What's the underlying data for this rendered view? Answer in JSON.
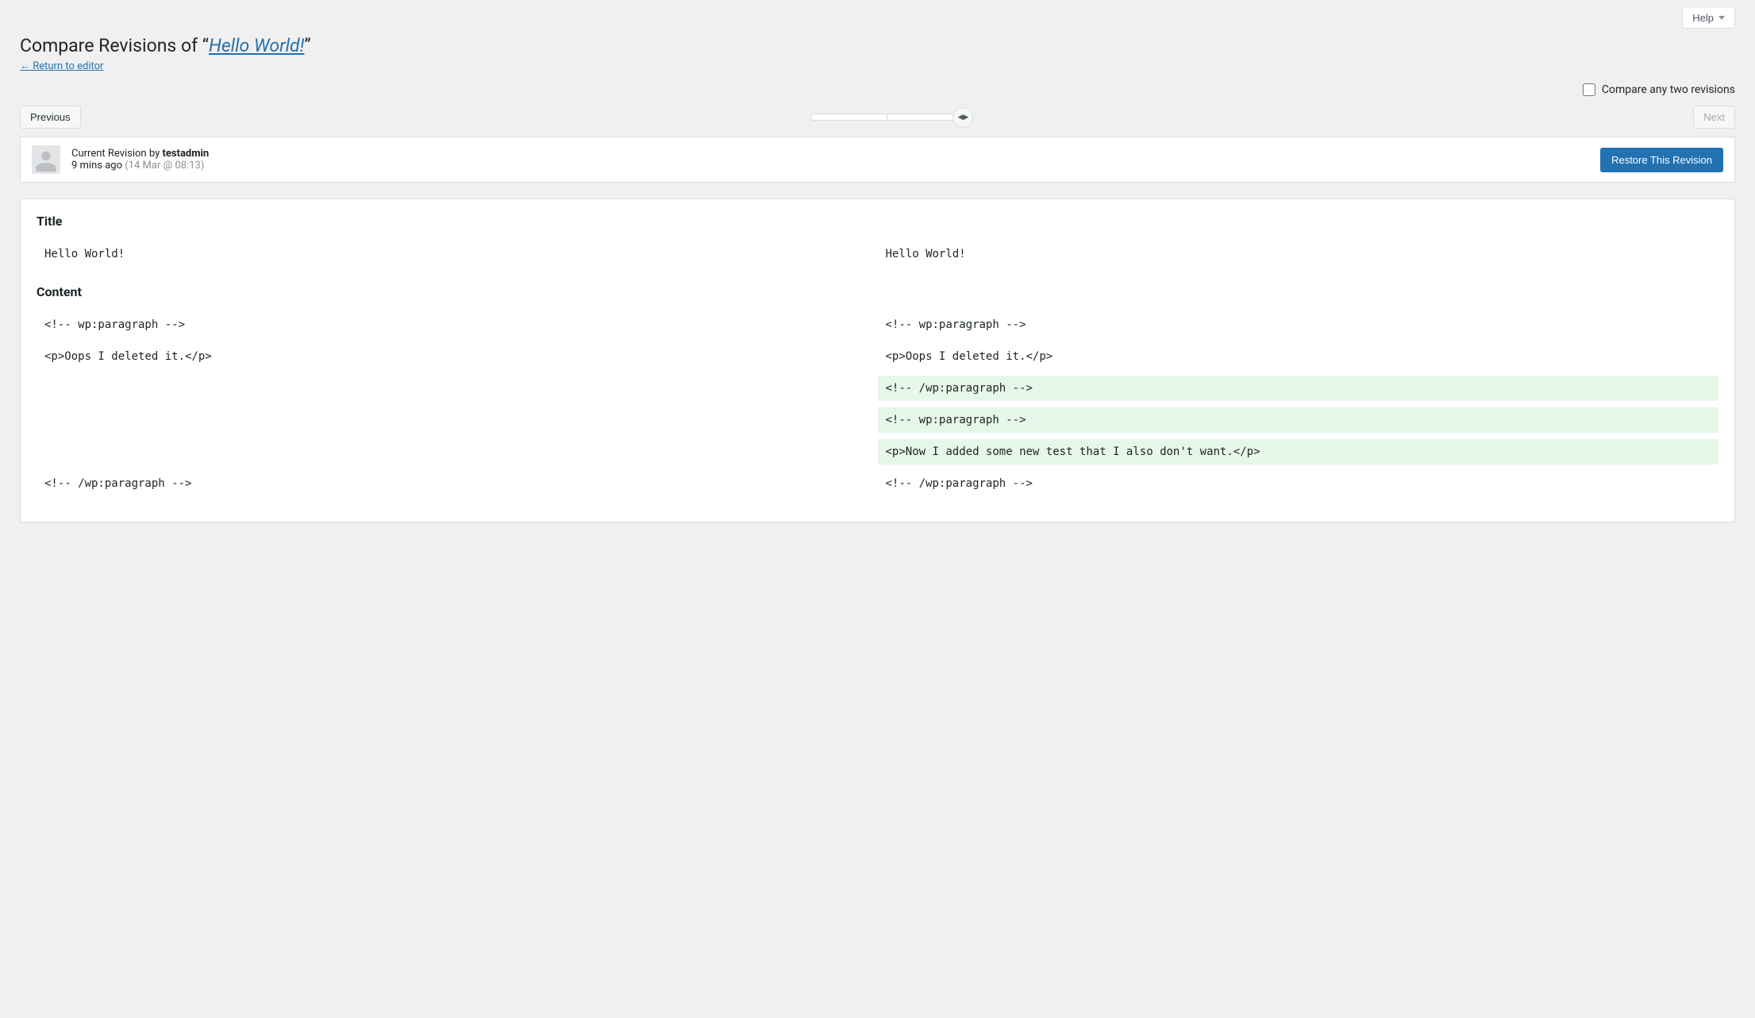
{
  "help_label": "Help",
  "heading": {
    "prefix": "Compare Revisions of “",
    "title_link": "Hello World!",
    "suffix": "”"
  },
  "return_link": "← Return to editor",
  "compare_toggle_label": "Compare any two revisions",
  "nav": {
    "previous": "Previous",
    "next": "Next"
  },
  "revision_meta": {
    "current_prefix": "Current Revision by ",
    "author": "testadmin",
    "ago": "9 mins ago",
    "timestamp": "(14 Mar @ 08:13)"
  },
  "restore_label": "Restore This Revision",
  "sections": {
    "title_label": "Title",
    "content_label": "Content"
  },
  "diff": {
    "title_rows": [
      {
        "left": "Hello World!",
        "right": "Hello World!",
        "type": "context"
      }
    ],
    "content_rows": [
      {
        "left": "<!-- wp:paragraph -->",
        "right": "<!-- wp:paragraph -->",
        "type": "context"
      },
      {
        "type": "spacer"
      },
      {
        "left": "<p>Oops I deleted it.</p>",
        "right": "<p>Oops I deleted it.</p>",
        "type": "context"
      },
      {
        "type": "spacer"
      },
      {
        "left": "",
        "right": "<!-- /wp:paragraph -->",
        "type": "added"
      },
      {
        "type": "spacer"
      },
      {
        "left": "",
        "right": "<!-- wp:paragraph -->",
        "type": "added"
      },
      {
        "type": "spacer"
      },
      {
        "left": "",
        "right": "<p>Now I added some new test that I also don't want.</p>",
        "type": "added"
      },
      {
        "type": "spacer"
      },
      {
        "left": "<!-- /wp:paragraph -->",
        "right": "<!-- /wp:paragraph -->",
        "type": "context"
      }
    ]
  }
}
